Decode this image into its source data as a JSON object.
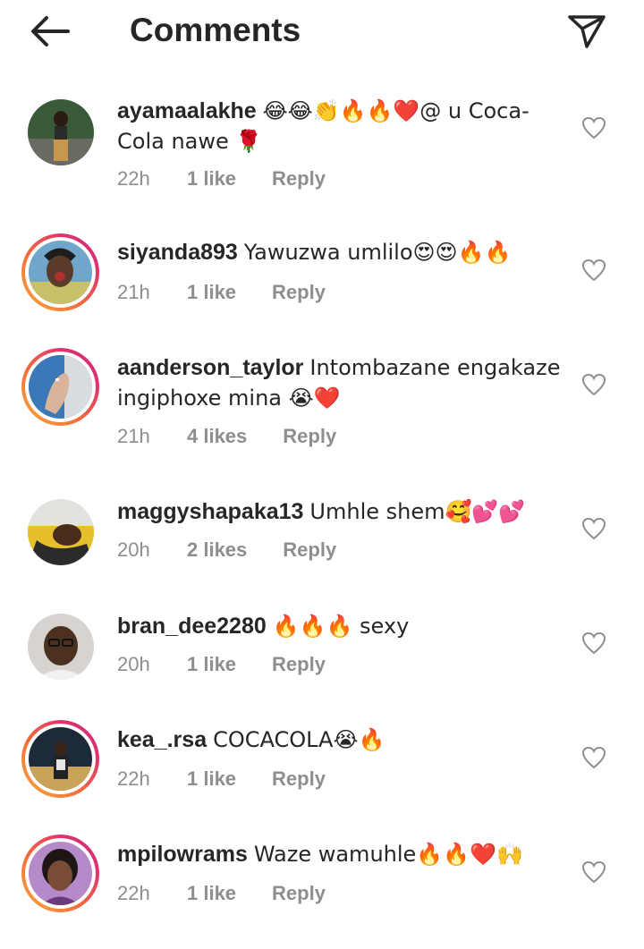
{
  "header": {
    "title": "Comments",
    "back_icon": "back-arrow-icon",
    "send_icon": "paper-plane-icon"
  },
  "comments": [
    {
      "username": "ayamaalakhe",
      "text": "😂😂👏🔥🔥❤️@ u Coca-Cola nawe 🌹",
      "time": "22h",
      "likes": "1 like",
      "reply": "Reply",
      "story_ring": false
    },
    {
      "username": "siyanda893",
      "text": "Yawuzwa umlilo😍😍🔥🔥",
      "time": "21h",
      "likes": "1 like",
      "reply": "Reply",
      "story_ring": true
    },
    {
      "username": "aanderson_taylor",
      "text": "Intombazane engakaze ingiphoxe mina 😭❤️",
      "time": "21h",
      "likes": "4 likes",
      "reply": "Reply",
      "story_ring": true
    },
    {
      "username": "maggyshapaka13",
      "text": "Umhle shem🥰💕💕",
      "time": "20h",
      "likes": "2 likes",
      "reply": "Reply",
      "story_ring": false
    },
    {
      "username": "bran_dee2280",
      "text": "🔥🔥🔥 sexy",
      "time": "20h",
      "likes": "1 like",
      "reply": "Reply",
      "story_ring": false
    },
    {
      "username": "kea_.rsa",
      "text": "COCACOLA😭🔥",
      "time": "22h",
      "likes": "1 like",
      "reply": "Reply",
      "story_ring": true
    },
    {
      "username": "mpilowrams",
      "text": "Waze wamuhle🔥🔥❤️🙌",
      "time": "22h",
      "likes": "1 like",
      "reply": "Reply",
      "story_ring": true
    }
  ]
}
